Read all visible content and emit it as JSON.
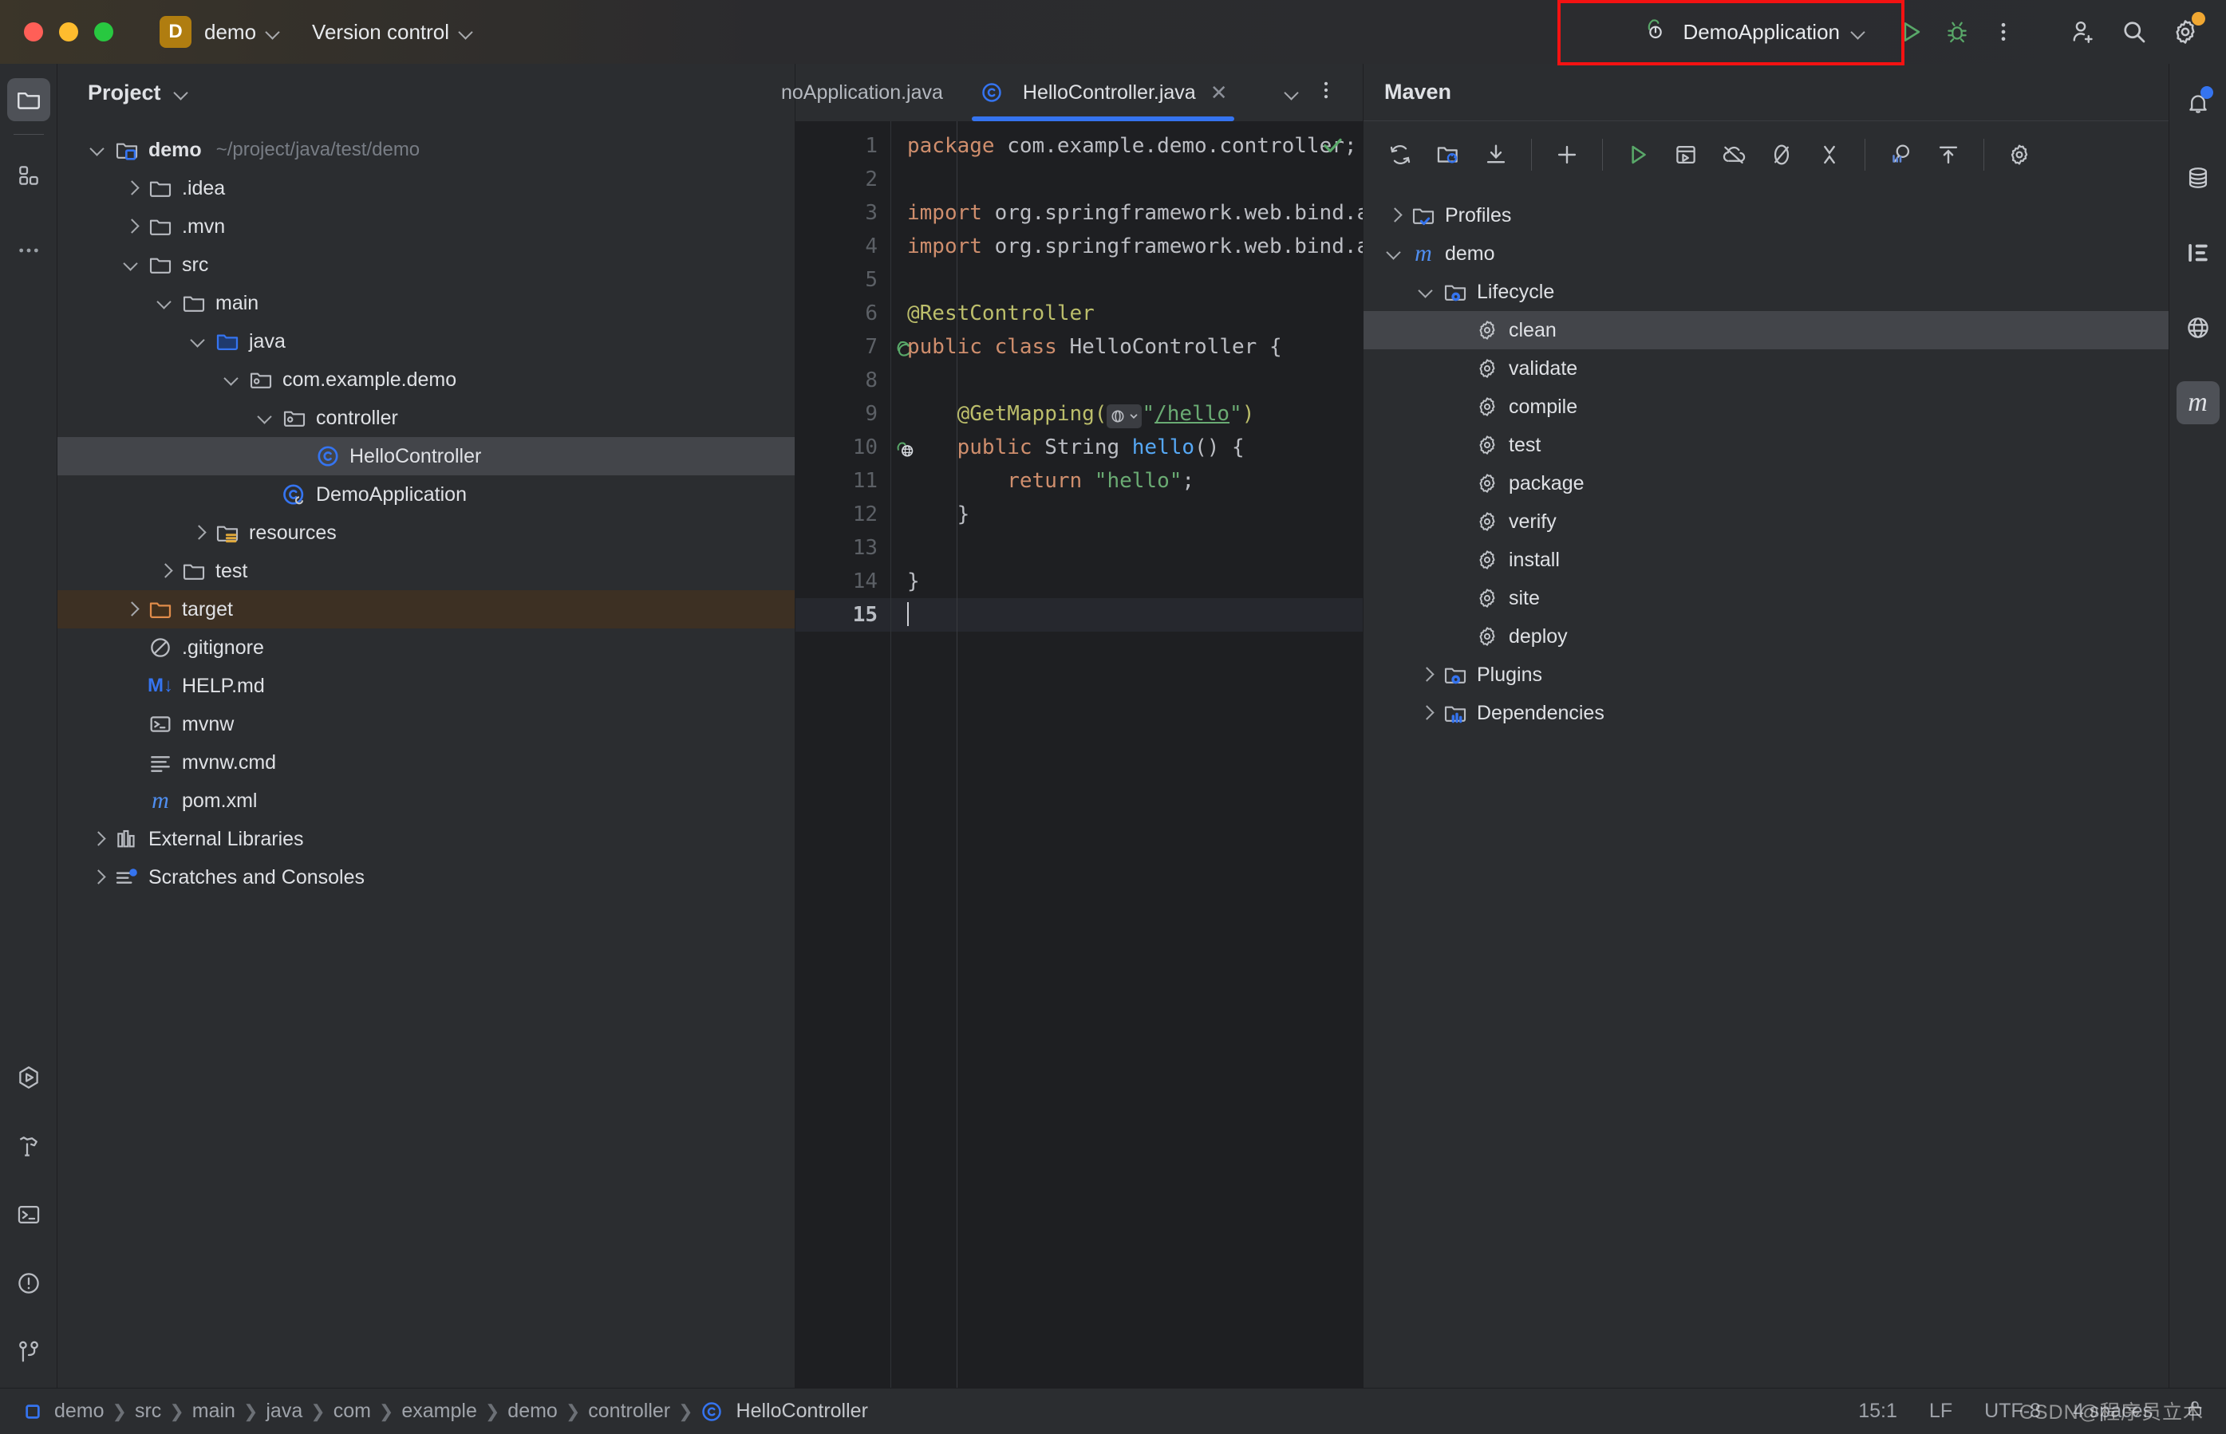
{
  "titlebar": {
    "project_badge": "D",
    "project_name": "demo",
    "version_control": "Version control",
    "run_config": "DemoApplication",
    "icons": {
      "run": "run-icon",
      "debug": "debug-icon",
      "more": "more-vertical-icon",
      "add_user": "add-user-icon",
      "search": "search-icon",
      "settings": "gear-icon"
    }
  },
  "left_rail": {
    "top": [
      {
        "name": "project-tool-window",
        "icon": "folder-icon",
        "active": true
      },
      {
        "name": "structure-tool-window",
        "icon": "blocks-icon",
        "active": false
      },
      {
        "name": "more-tool-windows",
        "icon": "ellipsis-icon",
        "active": false
      }
    ],
    "bottom": [
      {
        "name": "run-tool-window",
        "icon": "run-hex-icon"
      },
      {
        "name": "build-tool-window",
        "icon": "hammer-icon"
      },
      {
        "name": "terminal-tool-window",
        "icon": "terminal-icon"
      },
      {
        "name": "problems-tool-window",
        "icon": "warning-circle-icon"
      },
      {
        "name": "version-control-tool-window",
        "icon": "branch-icon"
      }
    ]
  },
  "right_rail": [
    {
      "name": "notifications",
      "icon": "bell-icon",
      "badge": true
    },
    {
      "name": "database",
      "icon": "database-icon",
      "badge": false
    },
    {
      "name": "structure",
      "icon": "structure-list-icon",
      "badge": false
    },
    {
      "name": "web",
      "icon": "globe-icon",
      "badge": false
    },
    {
      "name": "maven",
      "icon": "maven-m-icon",
      "badge": false,
      "active": true
    }
  ],
  "project": {
    "title": "Project",
    "tree": [
      {
        "depth": 0,
        "arrow": "down",
        "icon": "module-folder-icon",
        "label": "demo",
        "bold": true,
        "sub": "~/project/java/test/demo"
      },
      {
        "depth": 1,
        "arrow": "right",
        "icon": "folder-icon",
        "label": ".idea"
      },
      {
        "depth": 1,
        "arrow": "right",
        "icon": "folder-icon",
        "label": ".mvn"
      },
      {
        "depth": 1,
        "arrow": "down",
        "icon": "folder-icon",
        "label": "src"
      },
      {
        "depth": 2,
        "arrow": "down",
        "icon": "folder-icon",
        "label": "main"
      },
      {
        "depth": 3,
        "arrow": "down",
        "icon": "source-folder-icon",
        "label": "java"
      },
      {
        "depth": 4,
        "arrow": "down",
        "icon": "package-icon",
        "label": "com.example.demo"
      },
      {
        "depth": 5,
        "arrow": "down",
        "icon": "package-icon",
        "label": "controller"
      },
      {
        "depth": 6,
        "arrow": "none",
        "icon": "class-icon",
        "label": "HelloController",
        "selected": true
      },
      {
        "depth": 5,
        "arrow": "none",
        "icon": "spring-class-icon",
        "label": "DemoApplication"
      },
      {
        "depth": 3,
        "arrow": "right",
        "icon": "resources-folder-icon",
        "label": "resources"
      },
      {
        "depth": 2,
        "arrow": "right",
        "icon": "folder-icon",
        "label": "test"
      },
      {
        "depth": 1,
        "arrow": "right",
        "icon": "excluded-folder-icon",
        "label": "target",
        "highlight": true
      },
      {
        "depth": 1,
        "arrow": "none",
        "icon": "gitignore-icon",
        "label": ".gitignore"
      },
      {
        "depth": 1,
        "arrow": "none",
        "icon": "markdown-icon",
        "label": "HELP.md"
      },
      {
        "depth": 1,
        "arrow": "none",
        "icon": "shell-script-icon",
        "label": "mvnw"
      },
      {
        "depth": 1,
        "arrow": "none",
        "icon": "text-file-icon",
        "label": "mvnw.cmd"
      },
      {
        "depth": 1,
        "arrow": "none",
        "icon": "maven-m-icon",
        "label": "pom.xml"
      },
      {
        "depth": 0,
        "arrow": "right",
        "icon": "library-icon",
        "label": "External Libraries"
      },
      {
        "depth": 0,
        "arrow": "right",
        "icon": "scratches-icon",
        "label": "Scratches and Consoles"
      }
    ]
  },
  "editor": {
    "tabs": [
      {
        "label": "noApplication.java",
        "icon": "none",
        "active": false,
        "clipped": true
      },
      {
        "label": "HelloController.java",
        "icon": "class-icon",
        "active": true,
        "closable": true
      }
    ],
    "tab_actions": {
      "list": "chevron-down-icon",
      "options": "more-vertical-icon"
    },
    "inspection_status": "check-ok-icon",
    "current_line": 15,
    "lines": [
      {
        "n": 1,
        "tokens": [
          {
            "t": "kw",
            "v": "package"
          },
          {
            "t": "plain",
            "v": " com.example.demo.controller;"
          }
        ]
      },
      {
        "n": 2,
        "tokens": []
      },
      {
        "n": 3,
        "tokens": [
          {
            "t": "kw",
            "v": "import"
          },
          {
            "t": "plain",
            "v": " org.springframework.web.bind.annot"
          }
        ]
      },
      {
        "n": 4,
        "tokens": [
          {
            "t": "kw",
            "v": "import"
          },
          {
            "t": "plain",
            "v": " org.springframework.web.bind.annot"
          }
        ]
      },
      {
        "n": 5,
        "tokens": []
      },
      {
        "n": 6,
        "tokens": [
          {
            "t": "ann",
            "v": "@RestController"
          }
        ]
      },
      {
        "n": 7,
        "gutter_icon": "spring-bean-icon",
        "tokens": [
          {
            "t": "kw",
            "v": "public class"
          },
          {
            "t": "plain",
            "v": " HelloController {"
          }
        ]
      },
      {
        "n": 8,
        "tokens": []
      },
      {
        "n": 9,
        "tokens": [
          {
            "t": "plain",
            "v": "    "
          },
          {
            "t": "ann",
            "v": "@GetMapping("
          },
          {
            "t": "webicon",
            "v": ""
          },
          {
            "t": "str",
            "v": "\""
          },
          {
            "t": "lnk",
            "v": "/hello"
          },
          {
            "t": "str",
            "v": "\""
          },
          {
            "t": "ann",
            "v": ")"
          }
        ]
      },
      {
        "n": 10,
        "gutter_icon": "spring-endpoint-icon",
        "tokens": [
          {
            "t": "plain",
            "v": "    "
          },
          {
            "t": "kw",
            "v": "public"
          },
          {
            "t": "plain",
            "v": " String "
          },
          {
            "t": "meth",
            "v": "hello"
          },
          {
            "t": "plain",
            "v": "() {"
          }
        ]
      },
      {
        "n": 11,
        "indent": true,
        "tokens": [
          {
            "t": "plain",
            "v": "        "
          },
          {
            "t": "kw",
            "v": "return"
          },
          {
            "t": "str",
            "v": " \"hello\""
          },
          {
            "t": "plain",
            "v": ";"
          }
        ]
      },
      {
        "n": 12,
        "tokens": [
          {
            "t": "plain",
            "v": "    }"
          }
        ]
      },
      {
        "n": 13,
        "tokens": []
      },
      {
        "n": 14,
        "tokens": [
          {
            "t": "plain",
            "v": "}"
          }
        ]
      },
      {
        "n": 15,
        "current": true,
        "caret": true,
        "tokens": []
      }
    ]
  },
  "maven": {
    "title": "Maven",
    "toolbar": [
      {
        "name": "reload-all-projects-button",
        "icon": "reload-icon"
      },
      {
        "name": "generate-sources-button",
        "icon": "folder-refresh-icon"
      },
      {
        "name": "download-sources-button",
        "icon": "download-icon"
      },
      {
        "name": "add-maven-project-button",
        "icon": "plus-icon"
      },
      {
        "name": "run-maven-build-button",
        "icon": "run-icon"
      },
      {
        "name": "execute-maven-goal-button",
        "icon": "console-run-icon"
      },
      {
        "name": "toggle-offline-mode-button",
        "icon": "offline-icon"
      },
      {
        "name": "toggle-skip-tests-button",
        "icon": "skip-tests-icon"
      },
      {
        "name": "toggle-ignored-projects-button",
        "icon": "ignore-icon"
      },
      {
        "name": "show-dependencies-button",
        "icon": "dependency-icon"
      },
      {
        "name": "expand-collapse-button",
        "icon": "collapse-icon"
      },
      {
        "name": "maven-settings-button",
        "icon": "gear-icon"
      }
    ],
    "tree": [
      {
        "depth": 0,
        "arrow": "right",
        "icon": "profiles-folder-icon",
        "label": "Profiles"
      },
      {
        "depth": 0,
        "arrow": "down",
        "icon": "maven-m-icon",
        "label": "demo"
      },
      {
        "depth": 1,
        "arrow": "down",
        "icon": "lifecycle-folder-icon",
        "label": "Lifecycle"
      },
      {
        "depth": 2,
        "arrow": "none",
        "icon": "goal-icon",
        "label": "clean",
        "selected": true
      },
      {
        "depth": 2,
        "arrow": "none",
        "icon": "goal-icon",
        "label": "validate"
      },
      {
        "depth": 2,
        "arrow": "none",
        "icon": "goal-icon",
        "label": "compile"
      },
      {
        "depth": 2,
        "arrow": "none",
        "icon": "goal-icon",
        "label": "test"
      },
      {
        "depth": 2,
        "arrow": "none",
        "icon": "goal-icon",
        "label": "package"
      },
      {
        "depth": 2,
        "arrow": "none",
        "icon": "goal-icon",
        "label": "verify"
      },
      {
        "depth": 2,
        "arrow": "none",
        "icon": "goal-icon",
        "label": "install"
      },
      {
        "depth": 2,
        "arrow": "none",
        "icon": "goal-icon",
        "label": "site"
      },
      {
        "depth": 2,
        "arrow": "none",
        "icon": "goal-icon",
        "label": "deploy"
      },
      {
        "depth": 1,
        "arrow": "right",
        "icon": "plugins-folder-icon",
        "label": "Plugins"
      },
      {
        "depth": 1,
        "arrow": "right",
        "icon": "dependencies-folder-icon",
        "label": "Dependencies"
      }
    ]
  },
  "status_bar": {
    "breadcrumb": [
      "demo",
      "src",
      "main",
      "java",
      "com",
      "example",
      "demo",
      "controller",
      "HelloController"
    ],
    "caret_position": "15:1",
    "line_separator": "LF",
    "encoding": "UTF-8",
    "indent": "4 spaces",
    "watermark": "CSDN@程序员立木",
    "lock_icon": "lock-icon"
  },
  "colors": {
    "accent_blue": "#3574f0",
    "run_green": "#59a869",
    "keyword_orange": "#cf8e6d",
    "annotation_yellow": "#bcbe6b",
    "string_green": "#6aab73",
    "method_blue": "#56a8f5",
    "highlight_box_red": "#f41212",
    "target_folder_bg": "#3d3023",
    "selection_bg": "#43454a"
  }
}
